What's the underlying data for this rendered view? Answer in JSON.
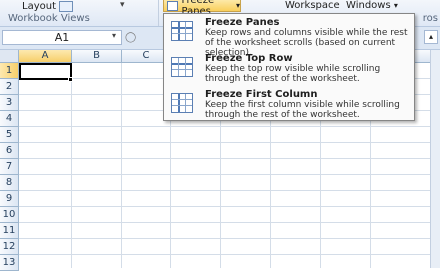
{
  "ribbon": {
    "layout_label": "Layout",
    "group_label": "Workbook Views",
    "freeze_panes_label": "Freeze Panes",
    "workspace_label": "Workspace",
    "windows_label": "Windows",
    "macros_label_partial": "ros"
  },
  "formula_bar": {
    "name_box": "A1"
  },
  "columns": [
    "A",
    "B",
    "C"
  ],
  "rows": [
    "1",
    "2",
    "3",
    "4",
    "5",
    "6",
    "7",
    "8",
    "9",
    "10",
    "11",
    "12",
    "13"
  ],
  "selected_cell": "A1",
  "freeze_menu": {
    "items": [
      {
        "title": "Freeze Panes",
        "description": "Keep rows and columns visible while the rest of the worksheet scrolls (based on current selection)."
      },
      {
        "title": "Freeze Top Row",
        "description": "Keep the top row visible while scrolling through the rest of the worksheet."
      },
      {
        "title": "Freeze First Column",
        "description": "Keep the first column visible while scrolling through the rest of the worksheet."
      }
    ]
  },
  "colors": {
    "highlight": "#f9cf5c",
    "header_border": "#9eb6ce",
    "icon_blue": "#4f79b5"
  }
}
